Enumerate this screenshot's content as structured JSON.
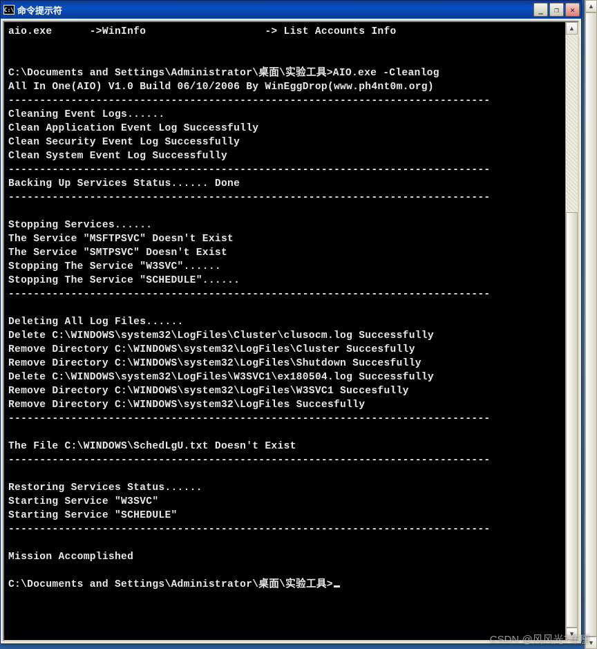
{
  "window": {
    "icon_label": "C:\\",
    "title": "命令提示符",
    "buttons": {
      "min": "_",
      "max": "❐",
      "close": "✕"
    }
  },
  "scrollbar": {
    "up": "▲",
    "down": "▼"
  },
  "console": {
    "header": "aio.exe      ->WinInfo                   -> List Accounts Info",
    "blank1": "",
    "blank2": "",
    "cmd1": "C:\\Documents and Settings\\Administrator\\桌面\\实验工具>AIO.exe -Cleanlog",
    "banner": "All In One(AIO) V1.0 Build 06/10/2006 By WinEggDrop(www.ph4nt0m.org)",
    "rule1": "-----------------------------------------------------------------------------",
    "l1": "Cleaning Event Logs......",
    "l2": "Clean Application Event Log Successfully",
    "l3": "Clean Security Event Log Successfully",
    "l4": "Clean System Event Log Successfully",
    "rule2": "-----------------------------------------------------------------------------",
    "l5": "Backing Up Services Status...... Done",
    "rule3": "-----------------------------------------------------------------------------",
    "blank3": "",
    "l6": "Stopping Services......",
    "l7": "The Service \"MSFTPSVC\" Doesn't Exist",
    "l8": "The Service \"SMTPSVC\" Doesn't Exist",
    "l9": "Stopping The Service \"W3SVC\"......",
    "l10": "Stopping The Service \"SCHEDULE\"......",
    "rule4": "-----------------------------------------------------------------------------",
    "blank4": "",
    "l11": "Deleting All Log Files......",
    "l12": "Delete C:\\WINDOWS\\system32\\LogFiles\\Cluster\\clusocm.log Successfully",
    "l13": "Remove Directory C:\\WINDOWS\\system32\\LogFiles\\Cluster Succesfully",
    "l14": "Remove Directory C:\\WINDOWS\\system32\\LogFiles\\Shutdown Succesfully",
    "l15": "Delete C:\\WINDOWS\\system32\\LogFiles\\W3SVC1\\ex180504.log Successfully",
    "l16": "Remove Directory C:\\WINDOWS\\system32\\LogFiles\\W3SVC1 Succesfully",
    "l17": "Remove Directory C:\\WINDOWS\\system32\\LogFiles Succesfully",
    "rule5": "-----------------------------------------------------------------------------",
    "blank5": "",
    "l18": "The File C:\\WINDOWS\\SchedLgU.txt Doesn't Exist",
    "rule6": "-----------------------------------------------------------------------------",
    "blank6": "",
    "l19": "Restoring Services Status......",
    "l20": "Starting Service \"W3SVC\"",
    "l21": "Starting Service \"SCHEDULE\"",
    "rule7": "-----------------------------------------------------------------------------",
    "blank7": "",
    "l22": "Mission Accomplished",
    "blank8": "",
    "prompt": "C:\\Documents and Settings\\Administrator\\桌面\\实验工具>"
  },
  "watermark": "CSDN @风风光7车厘"
}
